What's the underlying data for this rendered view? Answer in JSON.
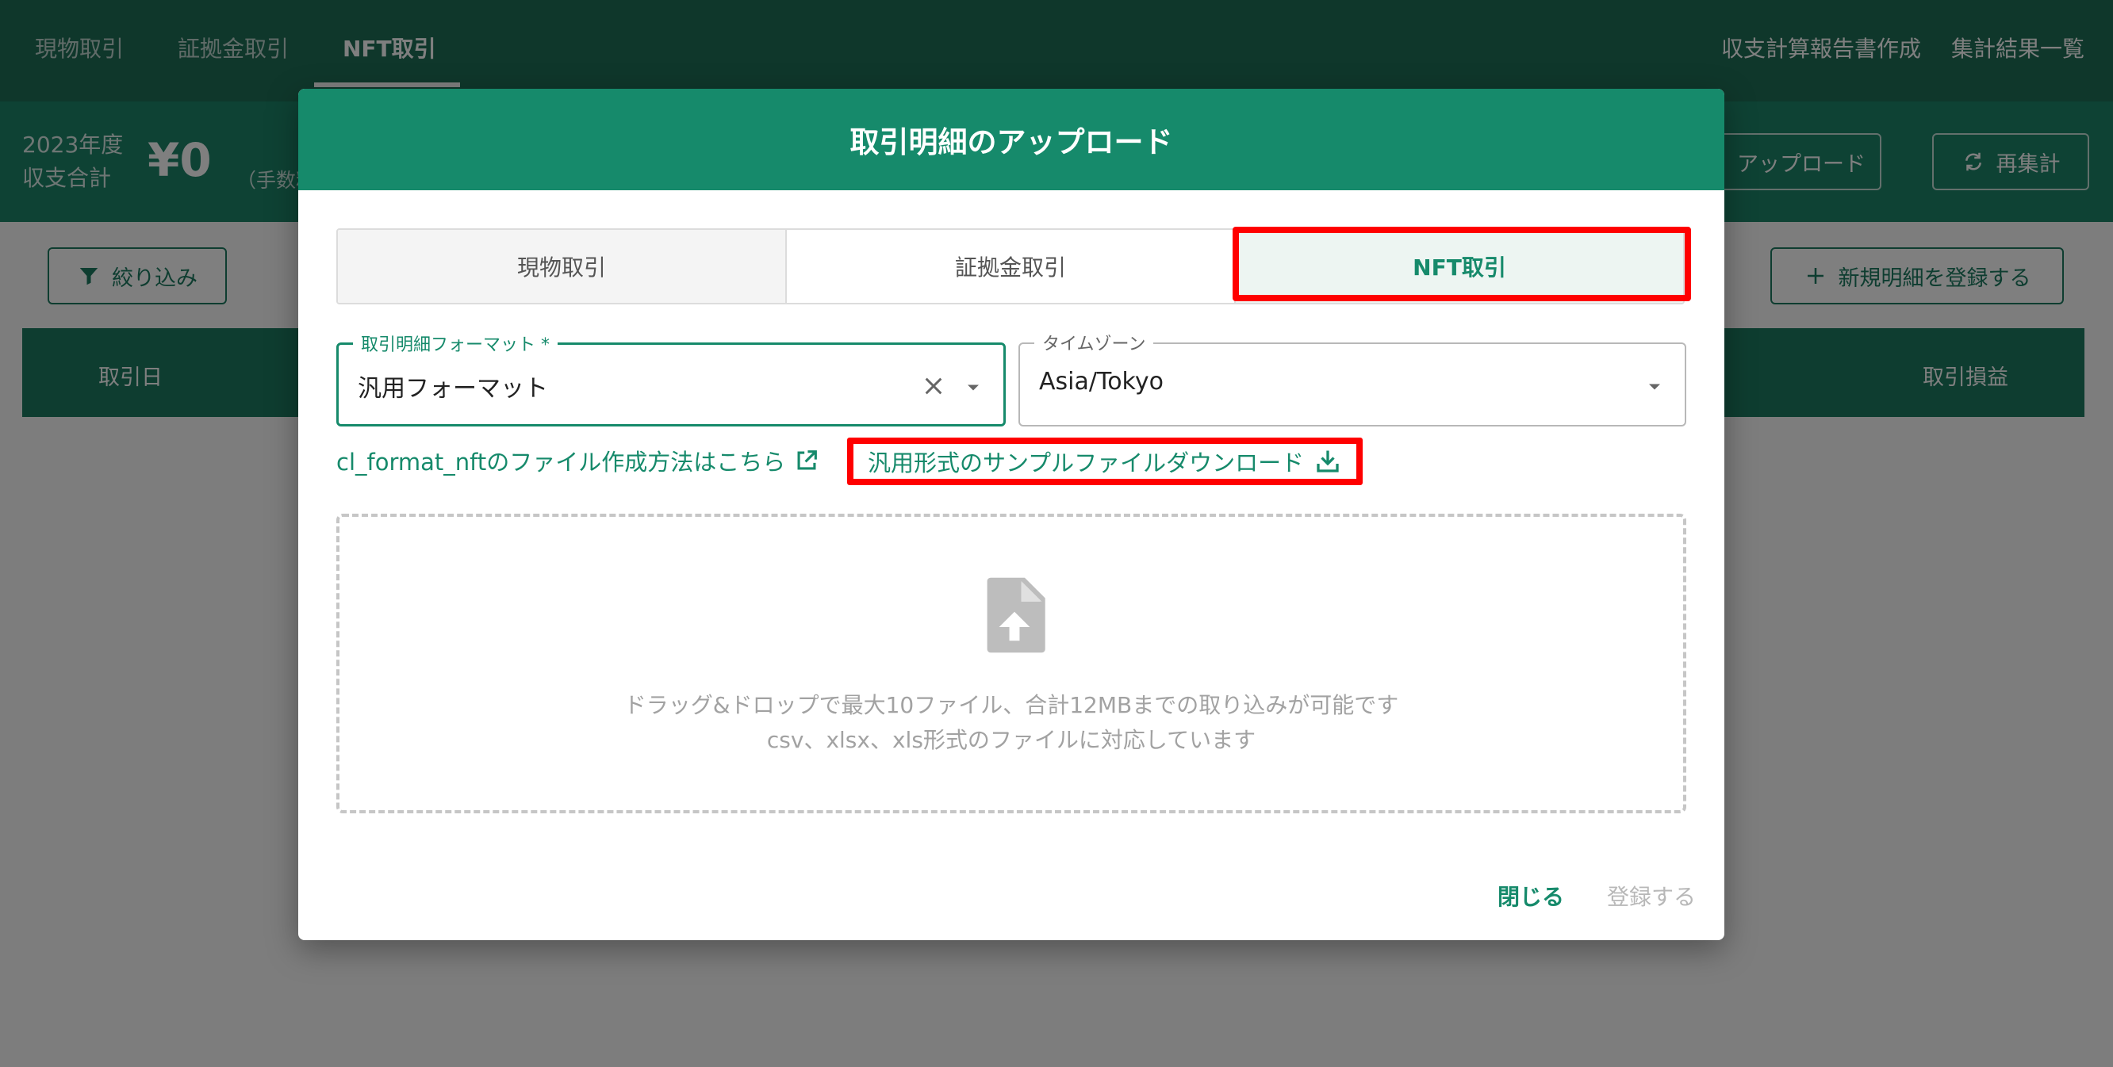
{
  "nav": {
    "tabs": [
      "現物取引",
      "証拠金取引",
      "NFT取引"
    ],
    "active_tab": "NFT取引",
    "right_links": [
      "収支計算報告書作成",
      "集計結果一覧"
    ]
  },
  "summary": {
    "year": "2023年度",
    "label": "収支合計",
    "amount": "¥0",
    "fee_note": "（手数料"
  },
  "header_actions": {
    "upload_label": "アップロード",
    "recalc_label": "再集計"
  },
  "toolbar": {
    "filter_label": "絞り込み",
    "new_entry_label": "新規明細を登録する"
  },
  "table": {
    "columns": [
      "取引日",
      "取引損益"
    ]
  },
  "modal": {
    "title": "取引明細のアップロード",
    "tabs": [
      "現物取引",
      "証拠金取引",
      "NFT取引"
    ],
    "active_tab": "NFT取引",
    "format_field": {
      "label": "取引明細フォーマット *",
      "value": "汎用フォーマット"
    },
    "timezone_field": {
      "label": "タイムゾーン",
      "value": "Asia/Tokyo"
    },
    "help_link": "cl_format_nftのファイル作成方法はこちら",
    "sample_download_link": "汎用形式のサンプルファイルダウンロード",
    "dropzone": {
      "line1": "ドラッグ&ドロップで最大10ファイル、合計12MBまでの取り込みが可能です",
      "line2": "csv、xlsx、xls形式のファイルに対応しています"
    },
    "close_label": "閉じる",
    "register_label": "登録する"
  },
  "colors": {
    "primary": "#168a6b",
    "nav_bg": "#1f6f57",
    "highlight": "#ff0000"
  },
  "icons": [
    "filter-icon",
    "plus-icon",
    "upload-icon",
    "refresh-icon",
    "clear-icon",
    "caret-down-icon",
    "external-link-icon",
    "download-icon",
    "file-upload-icon"
  ]
}
